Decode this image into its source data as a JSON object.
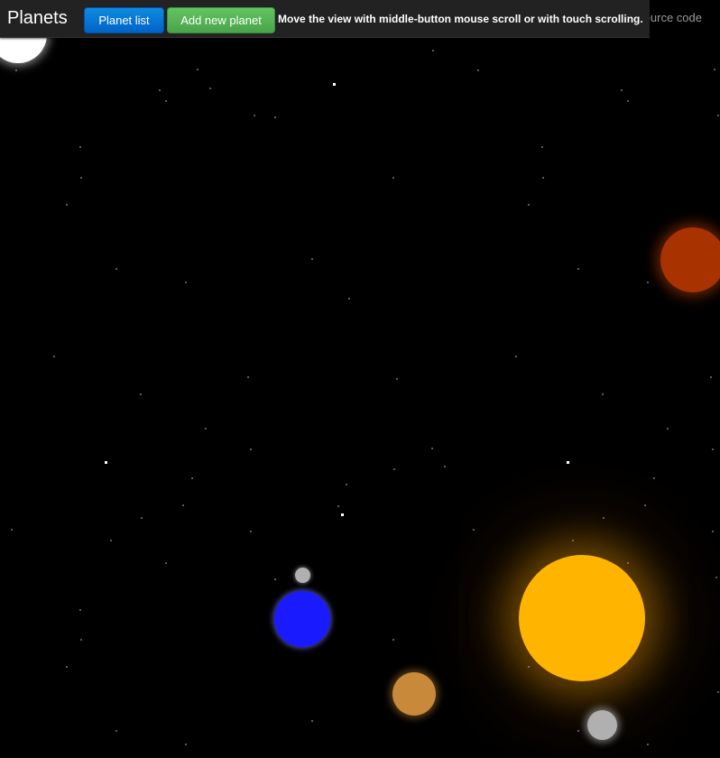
{
  "navbar": {
    "brand": "Planets",
    "planet_list_label": "Planet list",
    "add_planet_label": "Add new planet",
    "hint": "Move the view with middle-button mouse scroll or with touch scrolling.",
    "source_code_label": "Source code"
  },
  "colors": {
    "background": "#000000",
    "navbar": "#222222",
    "planet_list_button": "#0a7ad6",
    "add_planet_button": "#58b658",
    "sun": "#ffb400",
    "blue_planet": "#1a1aff",
    "orange_planet": "#c88a3a",
    "red_planet": "#a83200",
    "moon": "#b0b0b0",
    "white_body": "#ffffff"
  }
}
